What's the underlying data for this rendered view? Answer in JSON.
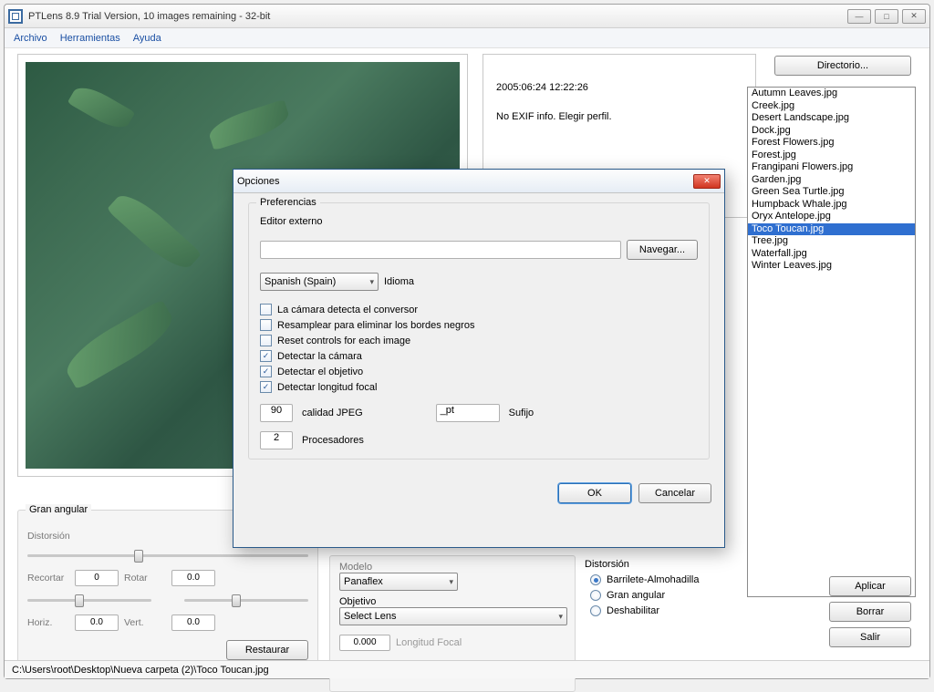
{
  "window": {
    "title": "PTLens 8.9 Trial Version, 10 images remaining - 32-bit"
  },
  "menu": {
    "file": "Archivo",
    "tools": "Herramientas",
    "help": "Ayuda"
  },
  "exif": {
    "timestamp": "2005:06:24 12:22:26",
    "info": "No EXIF info. Elegir perfil."
  },
  "buttons": {
    "directory": "Directorio...",
    "apply": "Aplicar",
    "clear": "Borrar",
    "exit": "Salir",
    "restore": "Restaurar",
    "ok": "OK",
    "cancel": "Cancelar",
    "browse": "Navegar..."
  },
  "files": [
    "Autumn Leaves.jpg",
    "Creek.jpg",
    "Desert Landscape.jpg",
    "Dock.jpg",
    "Forest Flowers.jpg",
    "Forest.jpg",
    "Frangipani Flowers.jpg",
    "Garden.jpg",
    "Green Sea Turtle.jpg",
    "Humpback Whale.jpg",
    "Oryx Antelope.jpg",
    "Toco Toucan.jpg",
    "Tree.jpg",
    "Waterfall.jpg",
    "Winter Leaves.jpg"
  ],
  "selected_file_index": 11,
  "wideangle": {
    "title": "Gran angular",
    "distortion": "Distorsión",
    "crop": "Recortar",
    "rotate": "Rotar",
    "horiz": "Horiz.",
    "vert": "Vert.",
    "val_crop": "0",
    "val_rot": "0.0",
    "val_h": "0.0",
    "val_v": "0.0"
  },
  "camera": {
    "model_label": "Modelo",
    "model_value": "Panaflex",
    "lens_label": "Objetivo",
    "lens_value": "Select Lens",
    "focal_label": "Longitud Focal",
    "focal_value": "0.000"
  },
  "distortion": {
    "title": "Distorsión",
    "opt1": "Barrilete-Almohadilla",
    "opt2": "Gran angular",
    "opt3": "Deshabilitar"
  },
  "status": "C:\\Users\\root\\Desktop\\Nueva carpeta (2)\\Toco Toucan.jpg",
  "dialog": {
    "title": "Opciones",
    "group": "Preferencias",
    "ext_editor": "Editor externo",
    "lang_label": "Idioma",
    "lang_value": "Spanish (Spain)",
    "chk1": "La cámara detecta el conversor",
    "chk2": "Resamplear para eliminar los bordes negros",
    "chk3": "Reset controls for each image",
    "chk4": "Detectar la cámara",
    "chk5": "Detectar el objetivo",
    "chk6": "Detectar longitud focal",
    "jpeg_q": "90",
    "jpeg_label": "calidad JPEG",
    "suffix": "_pt",
    "suffix_label": "Sufijo",
    "procs": "2",
    "procs_label": "Procesadores"
  }
}
